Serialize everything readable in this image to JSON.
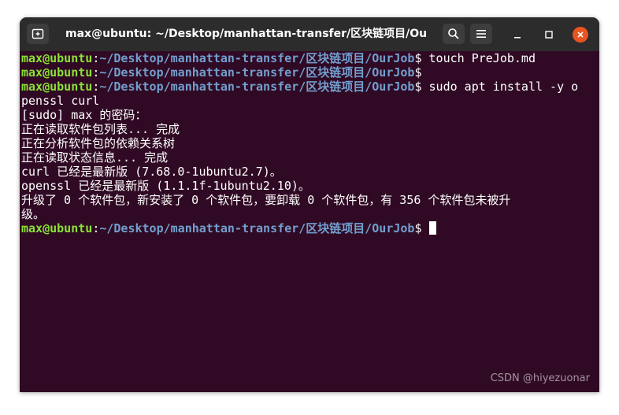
{
  "window": {
    "title": "max@ubuntu: ~/Desktop/manhattan-transfer/区块链项目/OurJob"
  },
  "prompt": {
    "user": "max@ubuntu",
    "colon": ":",
    "path": "~/Desktop/manhattan-transfer/区块链项目/OurJob",
    "symbol": "$"
  },
  "lines": [
    {
      "kind": "prompt",
      "command": " touch PreJob.md"
    },
    {
      "kind": "prompt",
      "command": ""
    },
    {
      "kind": "prompt",
      "command": " sudo apt install -y o"
    },
    {
      "kind": "output",
      "text": "penssl curl"
    },
    {
      "kind": "output",
      "text": "[sudo] max 的密码："
    },
    {
      "kind": "output",
      "text": "正在读取软件包列表... 完成"
    },
    {
      "kind": "output",
      "text": "正在分析软件包的依赖关系树"
    },
    {
      "kind": "output",
      "text": "正在读取状态信息... 完成"
    },
    {
      "kind": "output",
      "text": "curl 已经是最新版 (7.68.0-1ubuntu2.7)。"
    },
    {
      "kind": "output",
      "text": "openssl 已经是最新版 (1.1.1f-1ubuntu2.10)。"
    },
    {
      "kind": "output",
      "text": "升级了 0 个软件包，新安装了 0 个软件包，要卸载 0 个软件包，有 356 个软件包未被升"
    },
    {
      "kind": "output",
      "text": "级。"
    },
    {
      "kind": "prompt",
      "command": " ",
      "cursor": true
    }
  ],
  "watermark": "CSDN @hiyezuonar",
  "colors": {
    "terminal_bg": "#300a24",
    "titlebar_bg": "#2c2c2c",
    "prompt_user": "#8ae234",
    "prompt_path": "#729fcf",
    "close_button": "#e95420"
  },
  "icons": {
    "new_tab": "new-tab-icon",
    "search": "search-icon",
    "menu": "hamburger-menu-icon",
    "minimize": "minimize-icon",
    "maximize": "maximize-icon",
    "close": "close-icon"
  }
}
